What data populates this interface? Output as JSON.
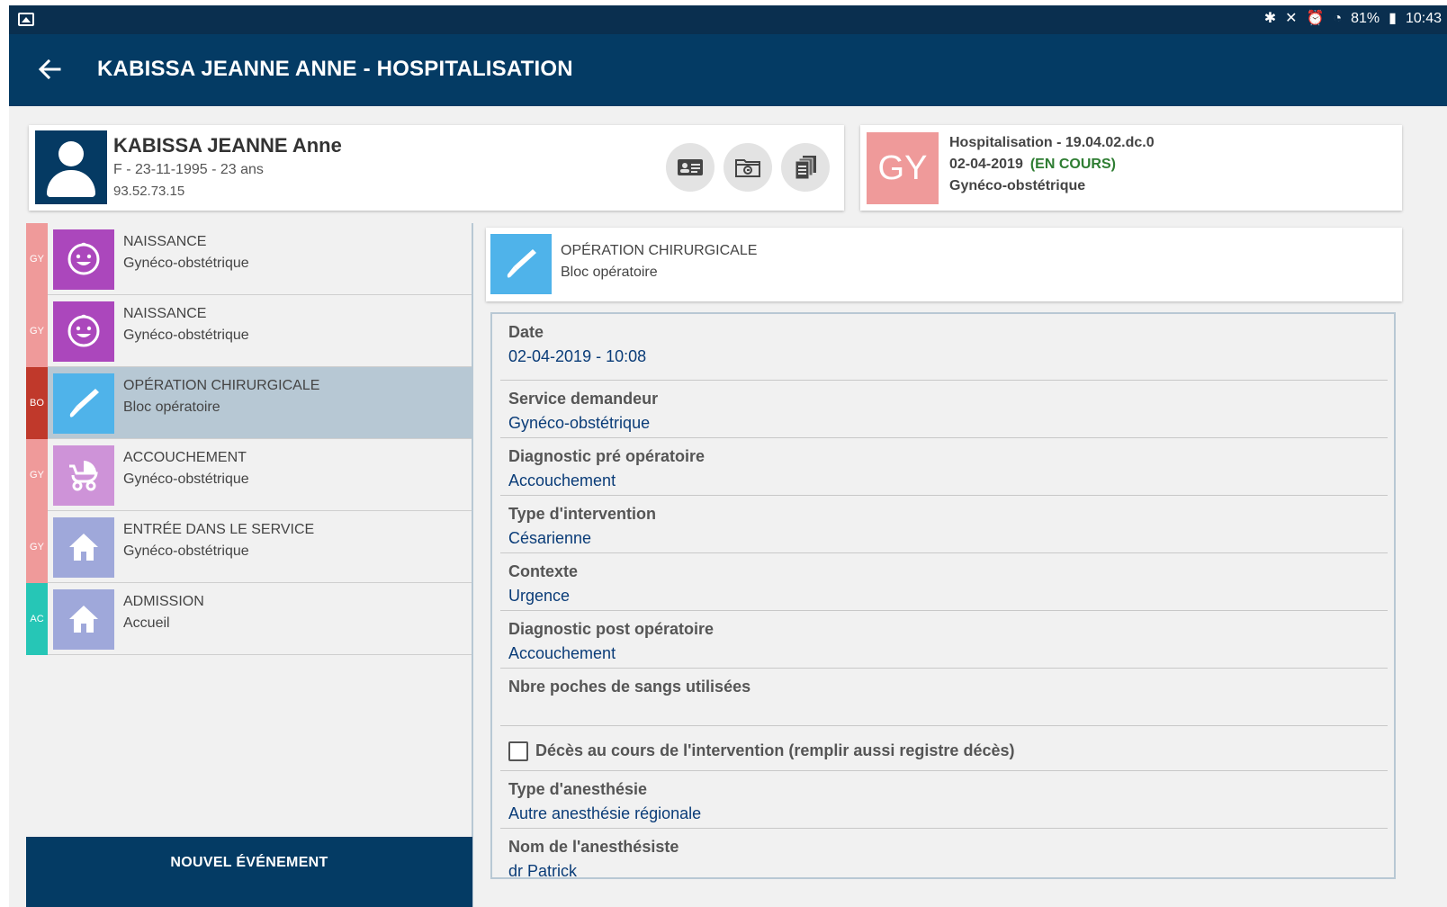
{
  "status_bar": {
    "battery": "81%",
    "time": "10:43"
  },
  "app_bar": {
    "title": "KABISSA JEANNE ANNE - HOSPITALISATION"
  },
  "patient": {
    "name": "KABISSA JEANNE Anne",
    "info": "F - 23-11-1995 - 23 ans",
    "id": "93.52.73.15"
  },
  "hospitalisation": {
    "badge": "GY",
    "badge_color": "#ef9a9a",
    "title": "Hospitalisation - 19.04.02.dc.0",
    "date": "02-04-2019",
    "status": "(EN COURS)",
    "service": "Gynéco-obstétrique"
  },
  "events": [
    {
      "tag": "GY",
      "tag_color": "#ef9a9a",
      "icon": "baby-face-icon",
      "icon_color": "#ab47bc",
      "type": "NAISSANCE",
      "service": "Gynéco-obstétrique",
      "selected": false
    },
    {
      "tag": "GY",
      "tag_color": "#ef9a9a",
      "icon": "baby-face-icon",
      "icon_color": "#ab47bc",
      "type": "NAISSANCE",
      "service": "Gynéco-obstétrique",
      "selected": false
    },
    {
      "tag": "BO",
      "tag_color": "#c0392b",
      "icon": "scalpel-icon",
      "icon_color": "#4fb3ea",
      "type": "OPÉRATION CHIRURGICALE",
      "service": "Bloc opératoire",
      "selected": true
    },
    {
      "tag": "GY",
      "tag_color": "#ef9a9a",
      "icon": "stroller-icon",
      "icon_color": "#ce93d8",
      "type": "ACCOUCHEMENT",
      "service": "Gynéco-obstétrique",
      "selected": false
    },
    {
      "tag": "GY",
      "tag_color": "#ef9a9a",
      "icon": "home-icon",
      "icon_color": "#9fa8da",
      "type": "ENTRÉE DANS LE SERVICE",
      "service": "Gynéco-obstétrique",
      "selected": false
    },
    {
      "tag": "AC",
      "tag_color": "#26c6b6",
      "icon": "home-icon",
      "icon_color": "#9fa8da",
      "type": "ADMISSION",
      "service": "Accueil",
      "selected": false
    }
  ],
  "new_event_label": "NOUVEL ÉVÉNEMENT",
  "detail": {
    "type": "OPÉRATION CHIRURGICALE",
    "service": "Bloc opératoire",
    "fields": [
      {
        "label": "Date",
        "value": "02-04-2019 - 10:08"
      },
      {
        "label": "Service demandeur",
        "value": "Gynéco-obstétrique"
      },
      {
        "label": "Diagnostic pré opératoire",
        "value": "Accouchement"
      },
      {
        "label": "Type d'intervention",
        "value": "Césarienne"
      },
      {
        "label": "Contexte",
        "value": "Urgence"
      },
      {
        "label": "Diagnostic post opératoire",
        "value": "Accouchement"
      },
      {
        "label": "Nbre poches de sangs utilisées",
        "value": ""
      }
    ],
    "checkbox": {
      "label": "Décès au cours de l'intervention (remplir aussi registre décès)",
      "checked": false
    },
    "fields_after": [
      {
        "label": "Type d'anesthésie",
        "value": "Autre anesthésie régionale"
      },
      {
        "label": "Nom de l'anesthésiste",
        "value": "dr Patrick"
      }
    ]
  }
}
